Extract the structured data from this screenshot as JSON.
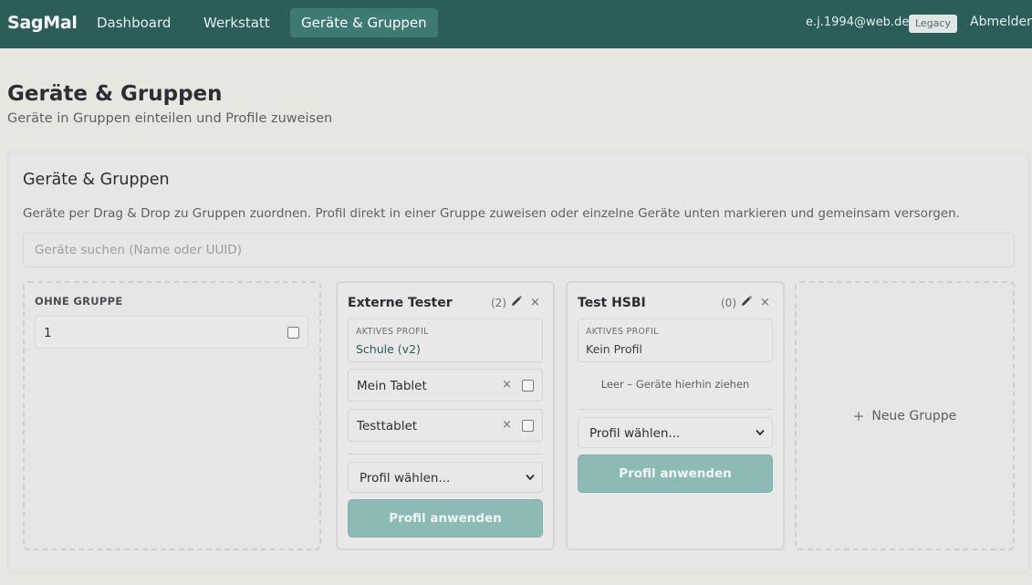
{
  "navbar": {
    "brand": "SagMal",
    "links": [
      "Dashboard",
      "Werkstatt",
      "Geräte & Gruppen"
    ],
    "active_index": 2,
    "user_email": "e.j.1994@web.de",
    "badge": "Legacy",
    "logout": "Abmelden"
  },
  "page": {
    "title": "Geräte & Gruppen",
    "subtitle": "Geräte in Gruppen einteilen und Profile zuweisen"
  },
  "card": {
    "title": "Geräte & Gruppen",
    "description": "Geräte per Drag & Drop zu Gruppen zuordnen. Profil direkt in einer Gruppe zuweisen oder einzelne Geräte unten markieren und gemeinsam versorgen.",
    "search_placeholder": "Geräte suchen (Name oder UUID)"
  },
  "ungrouped": {
    "label": "OHNE GRUPPE",
    "devices": [
      "1"
    ]
  },
  "groups": [
    {
      "name": "Externe Tester",
      "count": "(2)",
      "profile_label": "AKTIVES PROFIL",
      "profile_value": "Schule (v2)",
      "devices": [
        "Mein Tablet",
        "Testtablet"
      ],
      "select_value": "Profil wählen...",
      "apply_label": "Profil anwenden"
    },
    {
      "name": "Test HSBI",
      "count": "(0)",
      "profile_label": "AKTIVES PROFIL",
      "profile_value": "Kein Profil",
      "empty_hint": "Leer – Geräte hierhin ziehen",
      "select_value": "Profil wählen...",
      "apply_label": "Profil anwenden"
    }
  ],
  "new_group": {
    "plus": "+",
    "label": "Neue Gruppe"
  },
  "icons": {
    "remove": "×",
    "close": "×",
    "edit": "pencil-icon",
    "select": "chevron-down-icon"
  },
  "colors": {
    "navbar": "#2b5e58",
    "nav_active": "#3e7a73",
    "apply_button": "#8cbab5",
    "profile_link": "#2b5e58"
  }
}
